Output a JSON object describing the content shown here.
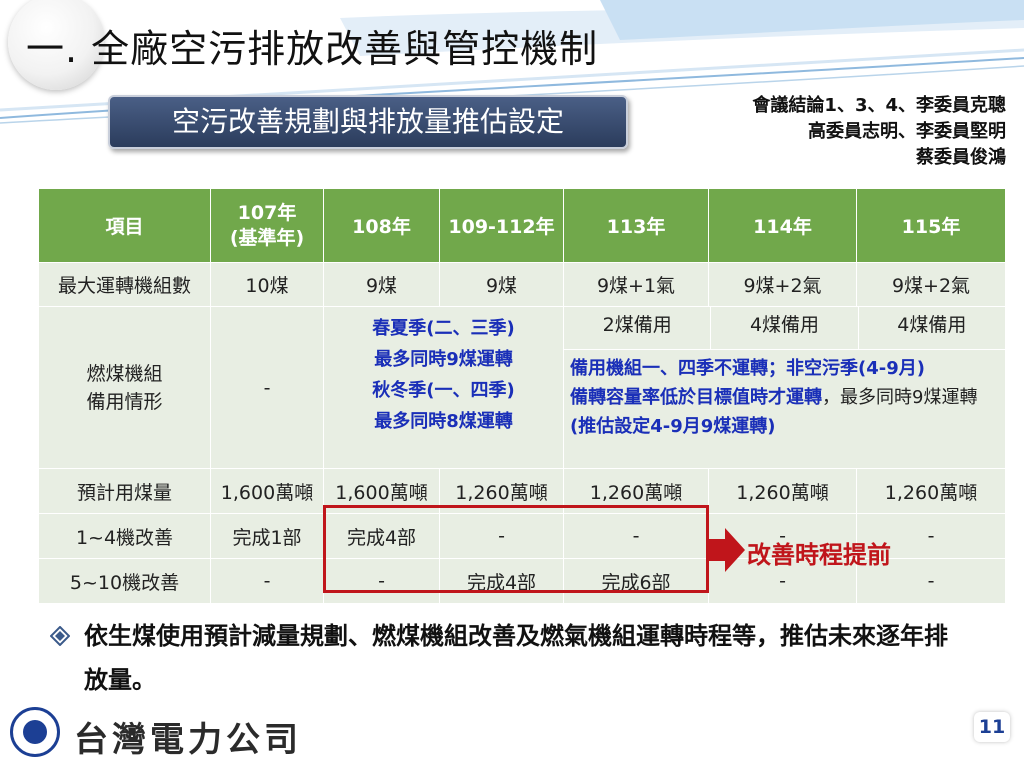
{
  "title": "一. 全廠空污排放改善與管控機制",
  "subtitle": "空污改善規劃與排放量推估設定",
  "meeting_notes": [
    "會議結論1、3、4、李委員克聰",
    "高委員志明、李委員堅明",
    "蔡委員俊鴻"
  ],
  "table": {
    "headers": [
      "項目",
      "107年\n(基準年)",
      "108年",
      "109-112年",
      "113年",
      "114年",
      "115年"
    ],
    "rows": {
      "max_units": [
        "最大運轉機組數",
        "10煤",
        "9煤",
        "9煤",
        "9煤+1氣",
        "9煤+2氣",
        "9煤+2氣"
      ],
      "coal_standby": {
        "label": "燃煤機組\n備用情形",
        "base": "-",
        "plan_lines": [
          "春夏季(二、三季)",
          "最多同時9煤運轉",
          "秋冬季(一、四季)",
          "最多同時8煤運轉"
        ],
        "standby_113": "2煤備用",
        "standby_114": "4煤備用",
        "standby_115": "4煤備用",
        "note_blue_1": "備用機組一、四季不運轉；非空污季(4-9月)",
        "note_blue_2": "備轉容量率低於目標值時才運轉",
        "note_plain": "，最多同時9煤運轉 ",
        "note_blue_3": "(推估設定4-9月9煤運轉)"
      },
      "coal_usage": [
        "預計用煤量",
        "1,600萬噸",
        "1,600萬噸",
        "1,260萬噸",
        "1,260萬噸",
        "1,260萬噸",
        "1,260萬噸"
      ],
      "units_1_4": [
        "1~4機改善",
        "完成1部",
        "完成4部",
        "-",
        "-",
        "-",
        "-"
      ],
      "units_5_10": [
        "5~10機改善",
        "-",
        "-",
        "完成4部",
        "完成6部",
        "-",
        "-"
      ]
    }
  },
  "callout": "改善時程提前",
  "bullet": "依生煤使用預計減量規劃、燃煤機組改善及燃氣機組運轉時程等，推估未來逐年排放量。",
  "company": "台灣電力公司",
  "page_number": "11",
  "colors": {
    "header_green": "#71a84b",
    "row_tint": "#e8eee3",
    "highlight_red": "#c0151b",
    "plan_blue": "#1a2fb8"
  }
}
